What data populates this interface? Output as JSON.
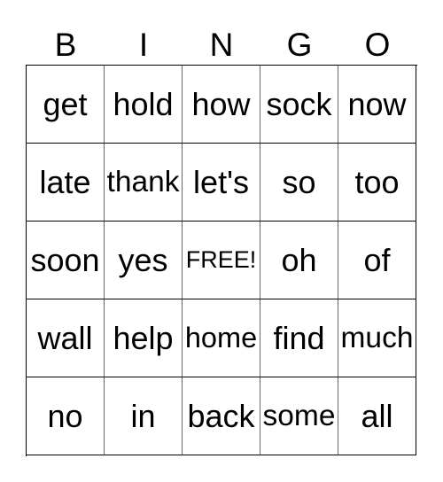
{
  "card": {
    "header": [
      "B",
      "I",
      "N",
      "G",
      "O"
    ],
    "rows": [
      [
        "get",
        "hold",
        "how",
        "sock",
        "now"
      ],
      [
        "late",
        "thank",
        "let's",
        "so",
        "too"
      ],
      [
        "soon",
        "yes",
        "FREE!",
        "oh",
        "of"
      ],
      [
        "wall",
        "help",
        "home",
        "find",
        "much"
      ],
      [
        "no",
        "in",
        "back",
        "some",
        "all"
      ]
    ],
    "free_space": "FREE!"
  }
}
